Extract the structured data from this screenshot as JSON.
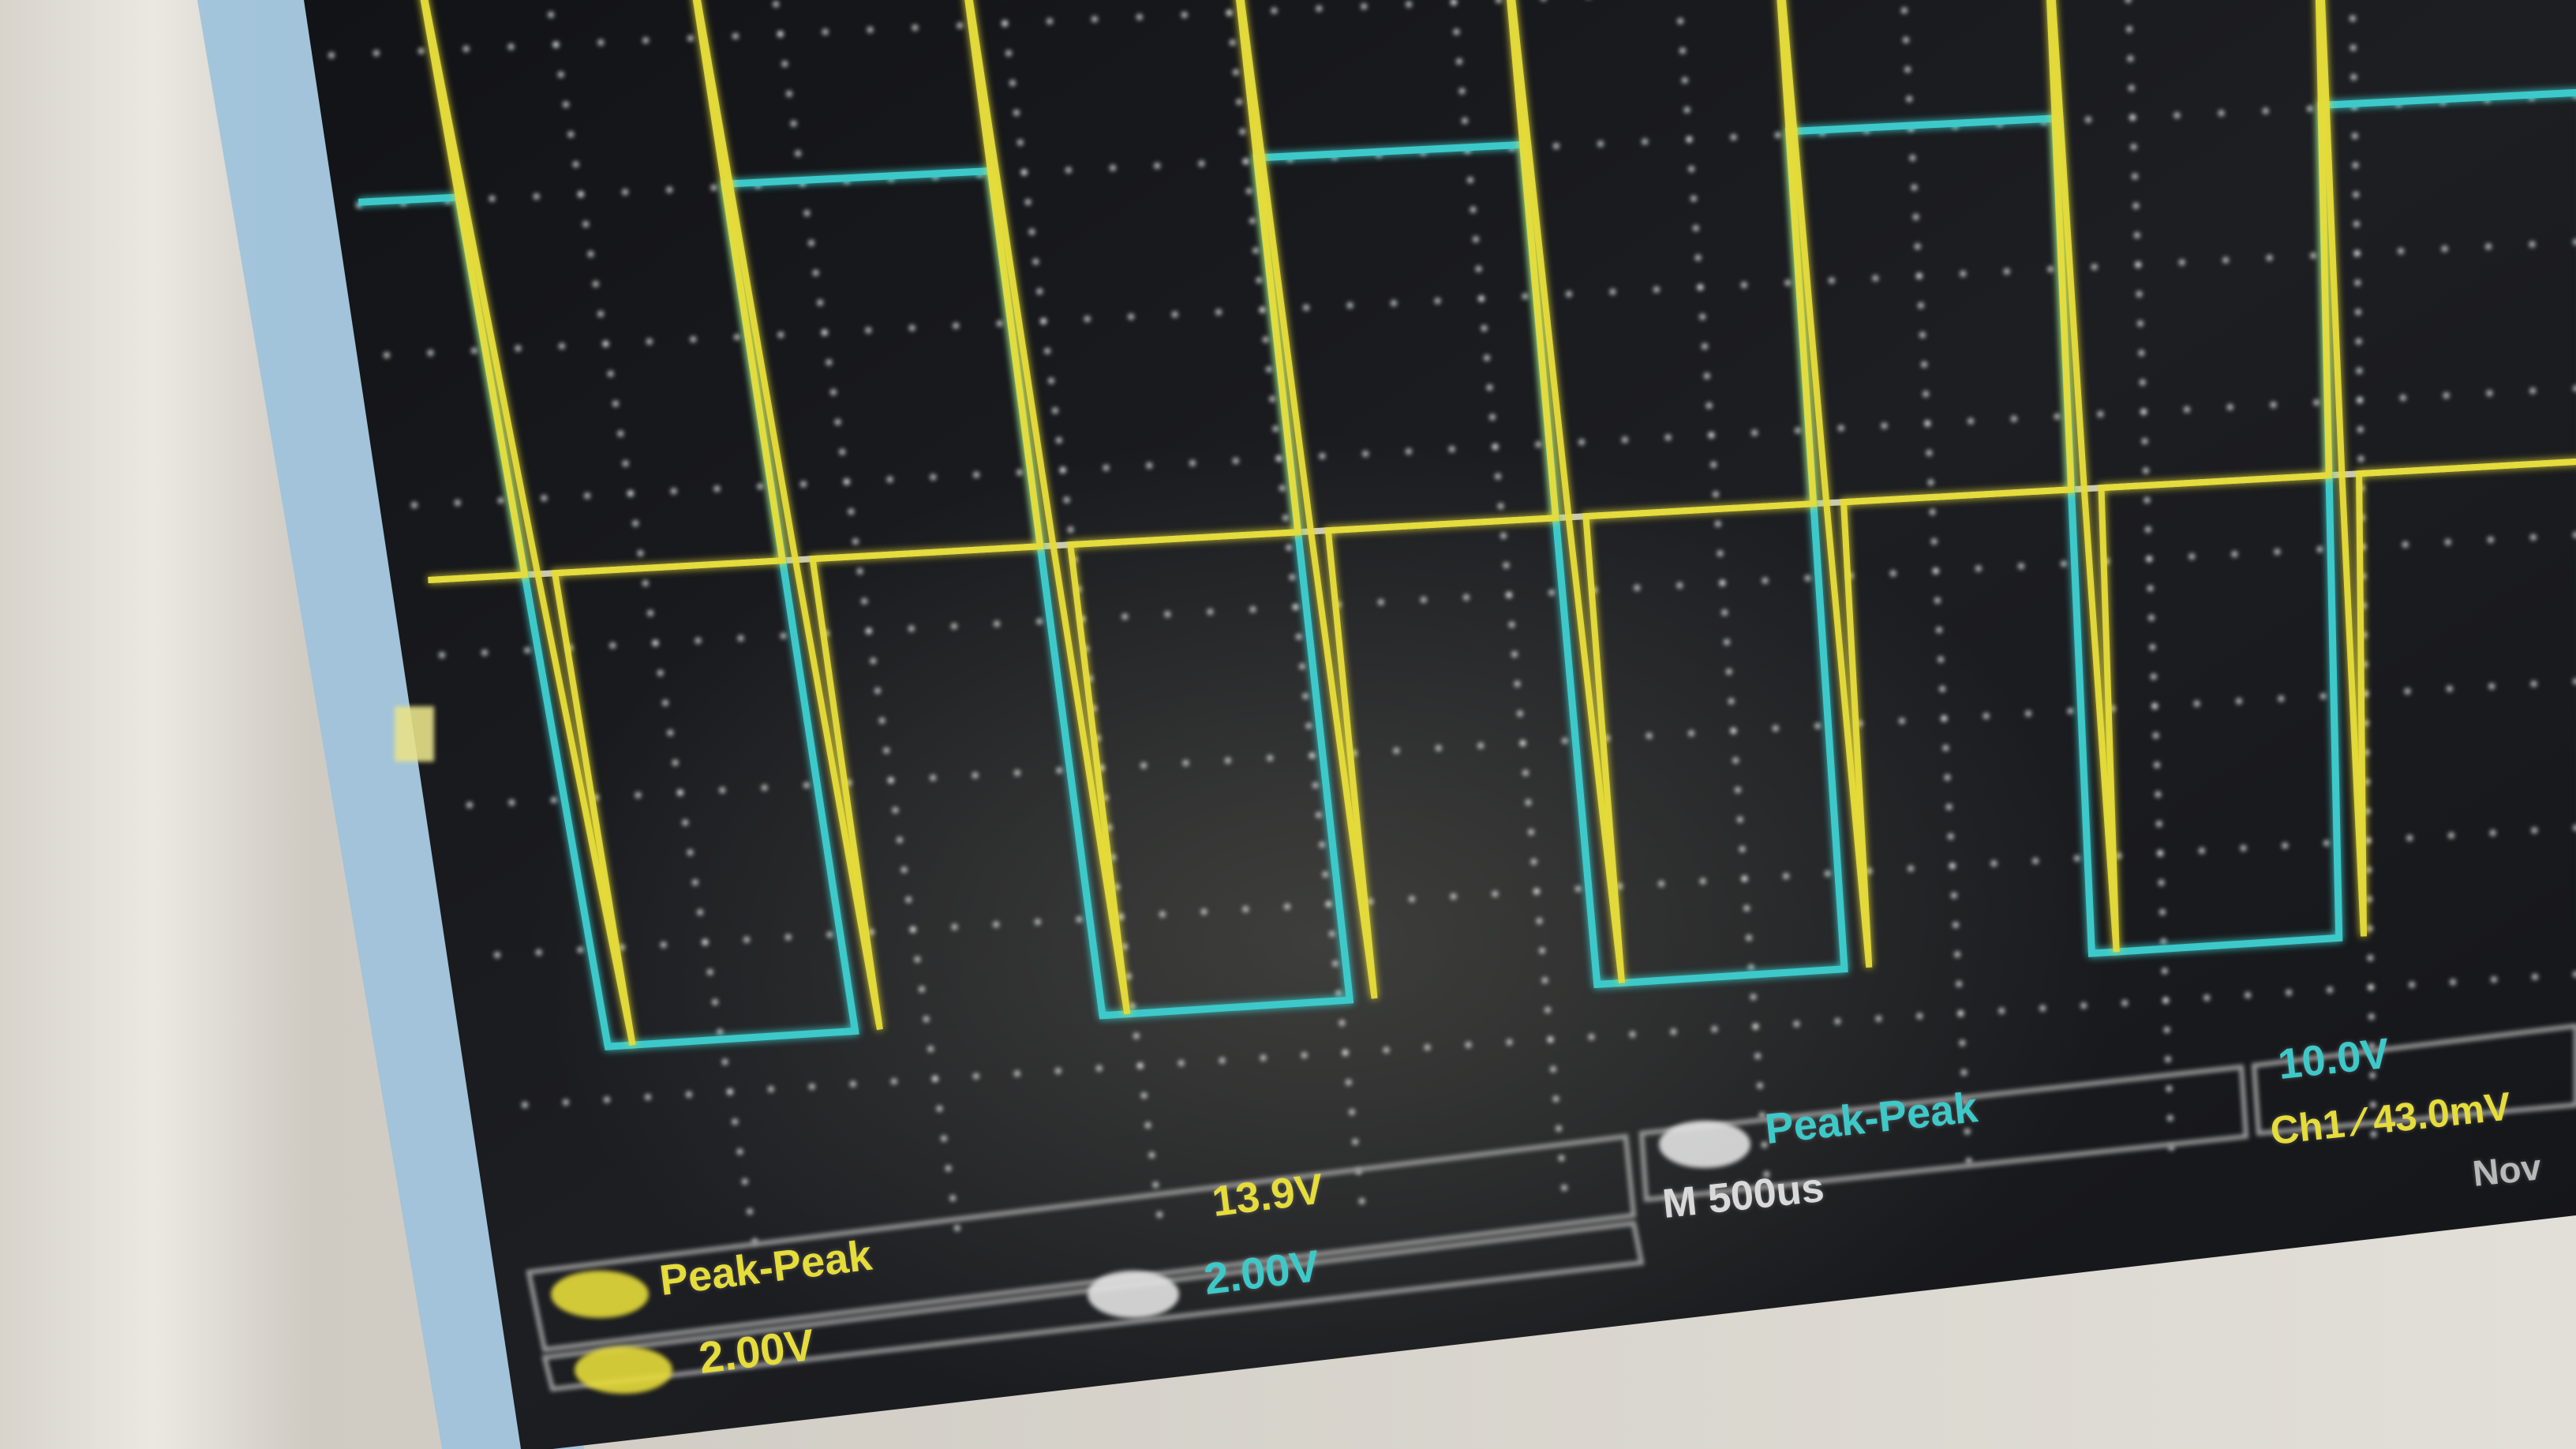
{
  "scene": "photo of oscilloscope display showing two square-wave traces",
  "colors": {
    "ch1": "#e6dc3a",
    "ch2": "#3ec9c9",
    "grid": "#e8e8e8",
    "screen": "#15161a"
  },
  "readouts": {
    "ch1_measure_label": "Peak-Peak",
    "ch1_measure_value": "13.9V",
    "ch1_scale": "2.00V",
    "ch2_measure_label": "Peak-Peak",
    "ch2_measure_value": "10.0V",
    "ch2_scale": "2.00V",
    "timebase": "M 500us",
    "trigger": "Ch1 ∕ 43.0mV",
    "date_partial": "Nov"
  }
}
